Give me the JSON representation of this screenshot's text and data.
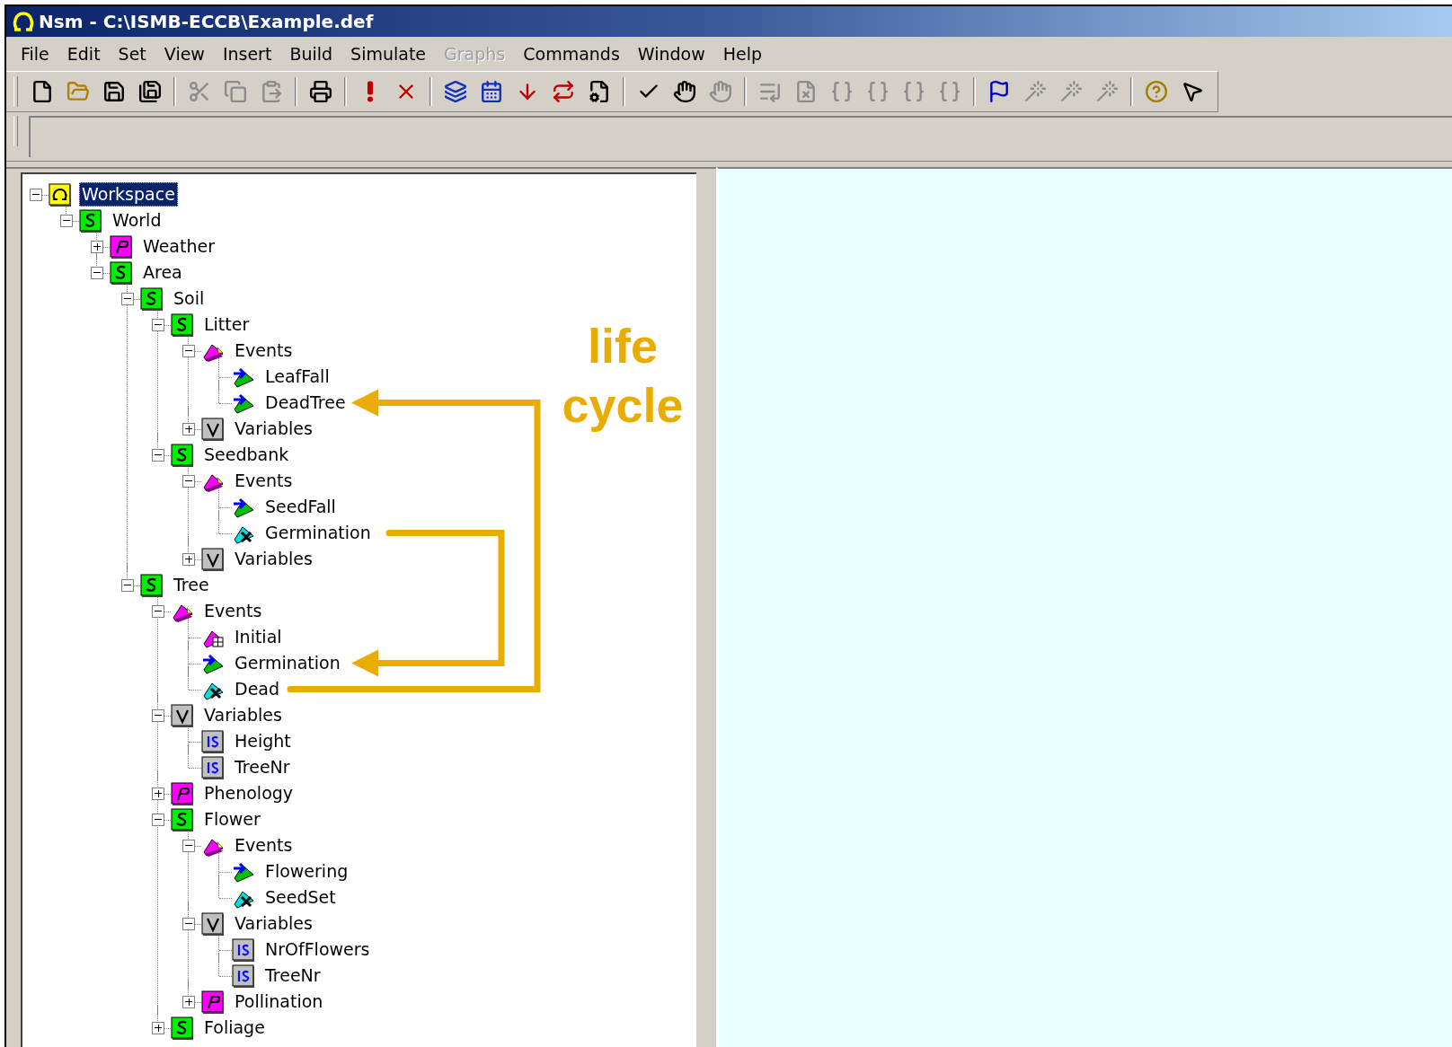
{
  "window": {
    "title": "Nsm - C:\\ISMB-ECCB\\Example.def"
  },
  "menu": [
    {
      "label": "File",
      "disabled": false
    },
    {
      "label": "Edit",
      "disabled": false
    },
    {
      "label": "Set",
      "disabled": false
    },
    {
      "label": "View",
      "disabled": false
    },
    {
      "label": "Insert",
      "disabled": false
    },
    {
      "label": "Build",
      "disabled": false
    },
    {
      "label": "Simulate",
      "disabled": false
    },
    {
      "label": "Graphs",
      "disabled": true
    },
    {
      "label": "Commands",
      "disabled": false
    },
    {
      "label": "Window",
      "disabled": false
    },
    {
      "label": "Help",
      "disabled": false
    }
  ],
  "toolbar": [
    [
      {
        "disabled": false
      },
      {
        "disabled": false
      },
      {
        "disabled": false
      },
      {
        "disabled": false
      }
    ],
    [
      {
        "disabled": true
      },
      {
        "disabled": true
      },
      {
        "disabled": true
      }
    ],
    [
      {
        "disabled": false
      }
    ],
    [
      {
        "disabled": false
      },
      {
        "disabled": false
      }
    ],
    [
      {
        "disabled": false
      },
      {
        "disabled": false
      },
      {
        "disabled": false
      },
      {
        "disabled": false
      },
      {
        "disabled": false
      }
    ],
    [
      {
        "disabled": false
      },
      {
        "disabled": false
      },
      {
        "disabled": true
      }
    ],
    [
      {
        "disabled": true
      },
      {
        "disabled": true
      },
      {
        "disabled": true
      },
      {
        "disabled": true
      },
      {
        "disabled": true
      },
      {
        "disabled": true
      }
    ],
    [
      {
        "disabled": false
      },
      {
        "disabled": true
      },
      {
        "disabled": true
      },
      {
        "disabled": true
      }
    ],
    [
      {
        "disabled": false
      },
      {
        "disabled": false
      }
    ]
  ],
  "tree": [
    {
      "label": "Workspace",
      "kind": "workspace",
      "expanded": true,
      "selected": true,
      "children": [
        {
          "label": "World",
          "kind": "submodel",
          "expanded": true,
          "selected": false,
          "children": [
            {
              "label": "Weather",
              "kind": "parameter",
              "expanded": false,
              "selected": false
            },
            {
              "label": "Area",
              "kind": "submodel",
              "expanded": true,
              "selected": false,
              "children": [
                {
                  "label": "Soil",
                  "kind": "submodel",
                  "expanded": true,
                  "selected": false,
                  "children": [
                    {
                      "label": "Litter",
                      "kind": "submodel",
                      "expanded": true,
                      "selected": false,
                      "children": [
                        {
                          "label": "Events",
                          "kind": "events",
                          "expanded": true,
                          "selected": false,
                          "children": [
                            {
                              "label": "LeafFall",
                              "kind": "event",
                              "selected": false
                            },
                            {
                              "label": "DeadTree",
                              "kind": "event",
                              "selected": false
                            }
                          ]
                        },
                        {
                          "label": "Variables",
                          "kind": "variables",
                          "expanded": false,
                          "selected": false
                        }
                      ]
                    },
                    {
                      "label": "Seedbank",
                      "kind": "submodel",
                      "expanded": true,
                      "selected": false,
                      "children": [
                        {
                          "label": "Events",
                          "kind": "events",
                          "expanded": true,
                          "selected": false,
                          "children": [
                            {
                              "label": "SeedFall",
                              "kind": "event",
                              "selected": false
                            },
                            {
                              "label": "Germination",
                              "kind": "state-event",
                              "selected": false
                            }
                          ]
                        },
                        {
                          "label": "Variables",
                          "kind": "variables",
                          "expanded": false,
                          "selected": false
                        }
                      ]
                    }
                  ]
                },
                {
                  "label": "Tree",
                  "kind": "submodel",
                  "expanded": true,
                  "selected": false,
                  "children": [
                    {
                      "label": "Events",
                      "kind": "events",
                      "expanded": true,
                      "selected": false,
                      "children": [
                        {
                          "label": "Initial",
                          "kind": "initial",
                          "selected": false
                        },
                        {
                          "label": "Germination",
                          "kind": "event",
                          "selected": false
                        },
                        {
                          "label": "Dead",
                          "kind": "state-event",
                          "selected": false
                        }
                      ]
                    },
                    {
                      "label": "Variables",
                      "kind": "variables",
                      "expanded": true,
                      "selected": false,
                      "children": [
                        {
                          "label": "Height",
                          "kind": "variable",
                          "selected": false
                        },
                        {
                          "label": "TreeNr",
                          "kind": "variable",
                          "selected": false
                        }
                      ]
                    },
                    {
                      "label": "Phenology",
                      "kind": "parameter",
                      "expanded": false,
                      "selected": false
                    },
                    {
                      "label": "Flower",
                      "kind": "submodel",
                      "expanded": true,
                      "selected": false,
                      "children": [
                        {
                          "label": "Events",
                          "kind": "events",
                          "expanded": true,
                          "selected": false,
                          "children": [
                            {
                              "label": "Flowering",
                              "kind": "event",
                              "selected": false
                            },
                            {
                              "label": "SeedSet",
                              "kind": "state-event",
                              "selected": false
                            }
                          ]
                        },
                        {
                          "label": "Variables",
                          "kind": "variables",
                          "expanded": true,
                          "selected": false,
                          "children": [
                            {
                              "label": "NrOfFlowers",
                              "kind": "variable",
                              "selected": false
                            },
                            {
                              "label": "TreeNr",
                              "kind": "variable",
                              "selected": false
                            }
                          ]
                        },
                        {
                          "label": "Pollination",
                          "kind": "parameter",
                          "expanded": false,
                          "selected": false
                        }
                      ]
                    },
                    {
                      "label": "Foliage",
                      "kind": "submodel",
                      "expanded": false,
                      "selected": false
                    }
                  ]
                }
              ]
            }
          ]
        }
      ]
    }
  ],
  "annotation": {
    "text": "life cycle"
  }
}
